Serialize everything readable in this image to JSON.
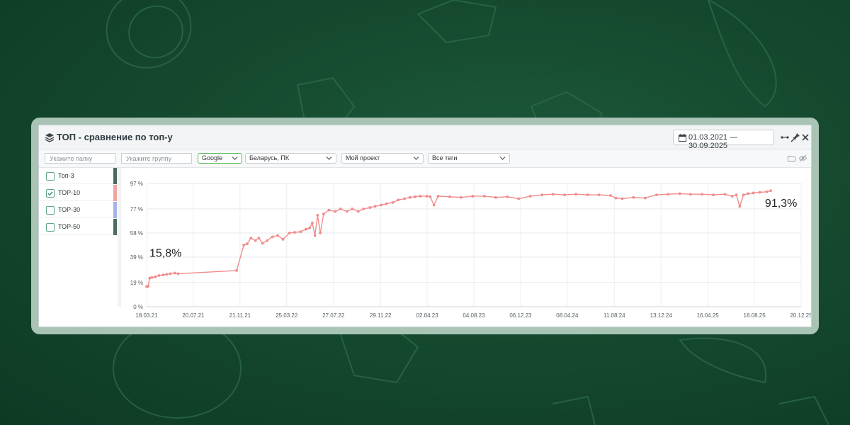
{
  "window": {
    "title": "ТОП - сравнение по топ-у",
    "date_range": "01.03.2021 — 30.09.2025"
  },
  "toolbar": {
    "folder_placeholder": "Укажите папку",
    "group_placeholder": "Укажите группу",
    "search_engine": "Google",
    "region": "Беларусь, ПК",
    "project": "Мой проект",
    "tags": "Все теги"
  },
  "sidebar": {
    "items": [
      {
        "label": "Топ-3",
        "checked": false,
        "color": "#4a6b62"
      },
      {
        "label": "ТОР-10",
        "checked": true,
        "color": "#f4a3a0"
      },
      {
        "label": "ТОР-30",
        "checked": false,
        "color": "#a7b3e8"
      },
      {
        "label": "ТОР-50",
        "checked": false,
        "color": "#4a6b62"
      }
    ]
  },
  "colors": {
    "accent": "#5cb85c",
    "series": "#f08c8c",
    "background": "#154a2f",
    "frame": "#a9c4b4"
  },
  "icons": [
    "layers-icon",
    "calendar-icon",
    "expand-icon",
    "pin-icon",
    "close-icon",
    "folder-icon",
    "eye-off-icon",
    "chevron-down-icon",
    "check-icon"
  ],
  "chart_data": {
    "type": "line",
    "series": [
      {
        "name": "ТОР-10",
        "points": [
          [
            "2021-03-18",
            15.8
          ],
          [
            "2021-03-22",
            16.0
          ],
          [
            "2021-03-26",
            22.5
          ],
          [
            "2021-04-01",
            23.0
          ],
          [
            "2021-04-10",
            23.5
          ],
          [
            "2021-04-20",
            24.5
          ],
          [
            "2021-05-01",
            25.0
          ],
          [
            "2021-05-10",
            25.5
          ],
          [
            "2021-05-20",
            26.0
          ],
          [
            "2021-06-01",
            26.5
          ],
          [
            "2021-06-10",
            26.0
          ],
          [
            "2021-11-12",
            28.5
          ],
          [
            "2021-12-01",
            48.5
          ],
          [
            "2021-12-10",
            49.5
          ],
          [
            "2021-12-20",
            54.0
          ],
          [
            "2022-01-01",
            52.0
          ],
          [
            "2022-01-10",
            54.0
          ],
          [
            "2022-01-20",
            50.0
          ],
          [
            "2022-02-01",
            52.0
          ],
          [
            "2022-02-15",
            55.0
          ],
          [
            "2022-03-01",
            56.0
          ],
          [
            "2022-03-15",
            53.0
          ],
          [
            "2022-04-01",
            58.0
          ],
          [
            "2022-04-15",
            58.5
          ],
          [
            "2022-05-01",
            59.0
          ],
          [
            "2022-05-15",
            61.0
          ],
          [
            "2022-05-25",
            62.0
          ],
          [
            "2022-06-01",
            66.0
          ],
          [
            "2022-06-08",
            56.0
          ],
          [
            "2022-06-15",
            72.0
          ],
          [
            "2022-06-22",
            58.0
          ],
          [
            "2022-07-01",
            73.0
          ],
          [
            "2022-07-15",
            76.0
          ],
          [
            "2022-08-01",
            75.0
          ],
          [
            "2022-08-15",
            77.0
          ],
          [
            "2022-09-01",
            75.0
          ],
          [
            "2022-09-15",
            77.0
          ],
          [
            "2022-10-01",
            75.0
          ],
          [
            "2022-10-15",
            77.0
          ],
          [
            "2022-11-01",
            78.0
          ],
          [
            "2022-11-15",
            79.0
          ],
          [
            "2022-12-01",
            80.0
          ],
          [
            "2022-12-15",
            81.0
          ],
          [
            "2023-01-01",
            82.0
          ],
          [
            "2023-01-15",
            84.0
          ],
          [
            "2023-02-01",
            85.0
          ],
          [
            "2023-02-15",
            86.0
          ],
          [
            "2023-03-01",
            86.5
          ],
          [
            "2023-03-15",
            87.0
          ],
          [
            "2023-04-01",
            87.0
          ],
          [
            "2023-04-10",
            86.5
          ],
          [
            "2023-04-20",
            80.0
          ],
          [
            "2023-05-01",
            87.0
          ],
          [
            "2023-06-01",
            86.5
          ],
          [
            "2023-07-01",
            86.0
          ],
          [
            "2023-08-01",
            87.0
          ],
          [
            "2023-09-01",
            87.0
          ],
          [
            "2023-10-01",
            86.0
          ],
          [
            "2023-11-01",
            86.5
          ],
          [
            "2023-12-01",
            85.0
          ],
          [
            "2024-01-01",
            87.0
          ],
          [
            "2024-02-01",
            88.0
          ],
          [
            "2024-03-01",
            88.5
          ],
          [
            "2024-04-01",
            88.0
          ],
          [
            "2024-05-01",
            88.5
          ],
          [
            "2024-06-01",
            88.0
          ],
          [
            "2024-07-01",
            88.0
          ],
          [
            "2024-08-01",
            87.5
          ],
          [
            "2024-08-15",
            85.5
          ],
          [
            "2024-09-01",
            85.0
          ],
          [
            "2024-10-01",
            86.0
          ],
          [
            "2024-11-01",
            85.5
          ],
          [
            "2024-12-01",
            88.0
          ],
          [
            "2025-01-01",
            88.5
          ],
          [
            "2025-02-01",
            89.0
          ],
          [
            "2025-03-01",
            88.5
          ],
          [
            "2025-04-01",
            88.5
          ],
          [
            "2025-05-01",
            88.0
          ],
          [
            "2025-06-01",
            88.5
          ],
          [
            "2025-06-20",
            87.0
          ],
          [
            "2025-07-01",
            88.0
          ],
          [
            "2025-07-10",
            79.0
          ],
          [
            "2025-07-20",
            88.0
          ],
          [
            "2025-08-01",
            89.0
          ],
          [
            "2025-08-15",
            89.5
          ],
          [
            "2025-09-01",
            90.0
          ],
          [
            "2025-09-20",
            90.5
          ],
          [
            "2025-09-30",
            91.3
          ]
        ]
      }
    ],
    "xticks": [
      "18.03.21",
      "20.07.21",
      "21.11.21",
      "25.03.22",
      "27.07.22",
      "29.11.22",
      "02.04.23",
      "04.08.23",
      "06.12.23",
      "08.04.24",
      "11.08.24",
      "13.12.24",
      "16.04.25",
      "18.08.25",
      "20.12.25"
    ],
    "yticks": [
      "0 %",
      "19 %",
      "39 %",
      "58 %",
      "77 %",
      "97 %"
    ],
    "ylim": [
      0,
      97
    ],
    "grid": true,
    "annotations": [
      "15,8%",
      "91,3%"
    ]
  }
}
